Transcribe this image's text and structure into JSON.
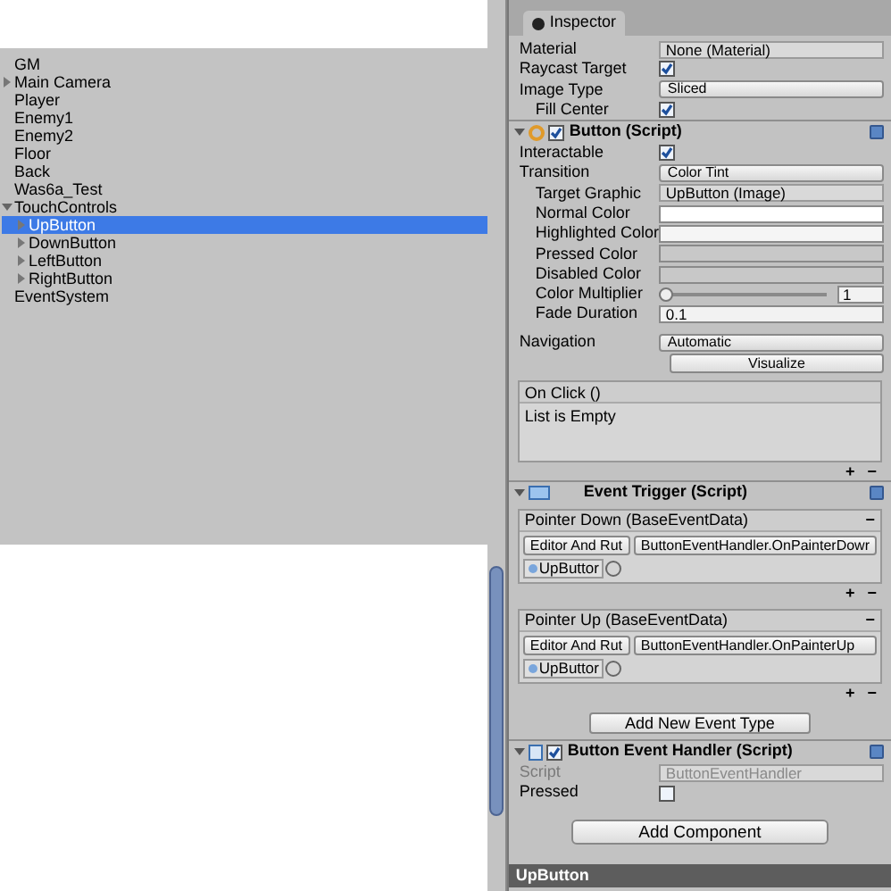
{
  "hierarchy": {
    "items": [
      {
        "label": "GM"
      },
      {
        "label": "Main Camera",
        "expanded": false
      },
      {
        "label": "Player"
      },
      {
        "label": "Enemy1"
      },
      {
        "label": "Enemy2"
      },
      {
        "label": "Floor"
      },
      {
        "label": "Back"
      },
      {
        "label": "Was6a_Test"
      },
      {
        "label": "TouchControls",
        "expanded": true,
        "children": [
          {
            "label": "UpButton",
            "expanded": false,
            "selected": true
          },
          {
            "label": "DownButton",
            "expanded": false,
            "selected": false
          },
          {
            "label": "LeftButton",
            "expanded": false,
            "selected": false
          },
          {
            "label": "RightButton",
            "expanded": false,
            "selected": false
          }
        ]
      },
      {
        "label": "EventSystem"
      }
    ]
  },
  "inspector": {
    "tab": "Inspector",
    "image_properties": [
      {
        "kind": "object",
        "label": "Material",
        "value": "None (Material)",
        "indent": false
      },
      {
        "kind": "checkbox",
        "label": "Raycast Target",
        "checked": true,
        "indent": false
      },
      {
        "kind": "dropdown",
        "label": "Image Type",
        "value": "Sliced",
        "indent": false
      },
      {
        "kind": "checkbox",
        "label": "Fill Center",
        "checked": true,
        "indent": true
      }
    ],
    "button_component": {
      "title": "Button (Script)",
      "enabled": true,
      "expanded": true,
      "properties": [
        {
          "kind": "checkbox",
          "label": "Interactable",
          "checked": true,
          "indent": false
        },
        {
          "kind": "dropdown",
          "label": "Transition",
          "value": "Color Tint",
          "indent": false
        },
        {
          "kind": "object",
          "label": "Target Graphic",
          "value": "UpButton (Image)",
          "indent": true
        },
        {
          "kind": "color",
          "label": "Normal Color",
          "color": "#ffffff",
          "indent": true
        },
        {
          "kind": "color",
          "label": "Highlighted Color",
          "color": "#f5f5f5",
          "indent": true
        },
        {
          "kind": "color",
          "label": "Pressed Color",
          "color": "#c8c8c8",
          "indent": true
        },
        {
          "kind": "color",
          "label": "Disabled Color",
          "color": "#c8c8c8",
          "indent": true
        },
        {
          "kind": "slider",
          "label": "Color Multiplier",
          "level": 0,
          "reading": "1",
          "indent": true
        },
        {
          "kind": "text",
          "label": "Fade Duration",
          "value": "0.1",
          "indent": true
        }
      ],
      "navigation": {
        "label": "Navigation",
        "value": "Automatic"
      },
      "visualize_button": "Visualize",
      "on_click": {
        "title": "On Click ()",
        "empty_text": "List is Empty",
        "add": "+",
        "remove": "−"
      }
    },
    "event_trigger": {
      "title": "Event Trigger (Script)",
      "expanded": true,
      "entries": [
        {
          "title": "Pointer Down (BaseEventData)",
          "remove": "−",
          "runtime": "Editor And Rut",
          "function": "ButtonEventHandler.OnPainterDowr",
          "target": "UpButtor",
          "add": "+",
          "remove_listener": "−"
        },
        {
          "title": "Pointer Up (BaseEventData)",
          "remove": "−",
          "runtime": "Editor And Rut",
          "function": "ButtonEventHandler.OnPainterUp",
          "target": "UpButtor",
          "add": "+",
          "remove_listener": "−"
        }
      ],
      "add_button": "Add New Event Type"
    },
    "handler_component": {
      "title": "Button Event Handler (Script)",
      "enabled": true,
      "expanded": true,
      "properties": [
        {
          "kind": "object",
          "label": "Script",
          "value": "ButtonEventHandler",
          "disabled": true
        },
        {
          "kind": "checkbox",
          "label": "Pressed",
          "checked": false,
          "disabled": false
        }
      ]
    },
    "add_component_button": "Add Component"
  },
  "status_bar": {
    "selection": "UpButton"
  }
}
